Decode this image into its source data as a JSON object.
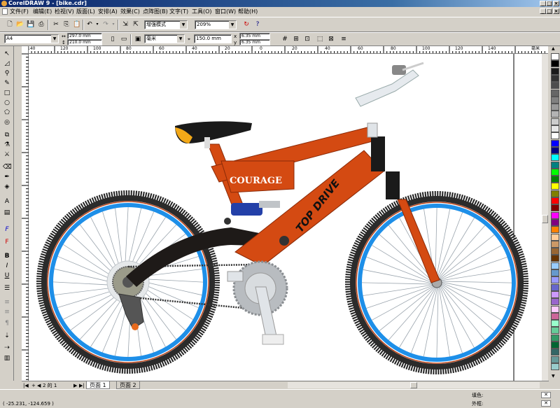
{
  "window": {
    "title": "CorelDRAW 9 - [bike.cdr]"
  },
  "menu": [
    "文件(F)",
    "编辑(E)",
    "检视(V)",
    "版面(L)",
    "安排(A)",
    "效果(C)",
    "点阵图(B)",
    "文字(T)",
    "工具(O)",
    "窗口(W)",
    "帮助(H)"
  ],
  "toolbar": {
    "view_mode": "增强模式",
    "zoom": "209%"
  },
  "property_bar": {
    "paper": "A4",
    "width": "297.0 mm",
    "height": "210.0 mm",
    "units": "毫米",
    "nudge": "150.0 mm",
    "dup_x": "6.35 mm",
    "dup_y": "6.35 mm"
  },
  "rulers": {
    "h_labels": [
      "140",
      "120",
      "100",
      "80",
      "60",
      "40",
      "20",
      "0",
      "20",
      "40",
      "60",
      "80",
      "100",
      "120",
      "140"
    ],
    "unit": "毫米"
  },
  "artwork": {
    "frame_text_1": "COURAGE",
    "frame_text_2": "TOP DRIVE"
  },
  "page_tabs": {
    "count": "2 的 1",
    "tab1": "页面 1",
    "tab2": "页面 2"
  },
  "status": {
    "coords": "( -25.231, -124.659 )",
    "fill_label": "填色:",
    "outline_label": "外框:"
  },
  "palette_colors": [
    "#ffffff",
    "#000000",
    "#1a1a1a",
    "#333333",
    "#4d4d4d",
    "#666666",
    "#808080",
    "#999999",
    "#b3b3b3",
    "#cccccc",
    "#e6e6e6",
    "#ffffff",
    "#0000ff",
    "#00007f",
    "#00ffff",
    "#008080",
    "#00ff00",
    "#008000",
    "#ffff00",
    "#808000",
    "#ff0000",
    "#800000",
    "#ff00ff",
    "#800080",
    "#ff8000",
    "#ffcc99",
    "#cc9966",
    "#996633",
    "#663300",
    "#99ccff",
    "#6699cc",
    "#9999ff",
    "#6666cc",
    "#cc99ff",
    "#9966cc",
    "#ffccff",
    "#cc6699",
    "#99ffcc",
    "#66cc99",
    "#339966",
    "#006633",
    "#336666",
    "#669999",
    "#99cccc"
  ],
  "colors": {
    "frame": "#d44a12",
    "rim": "#1e8fe8",
    "tire": "#222222",
    "title_bar": "#0a246a"
  }
}
